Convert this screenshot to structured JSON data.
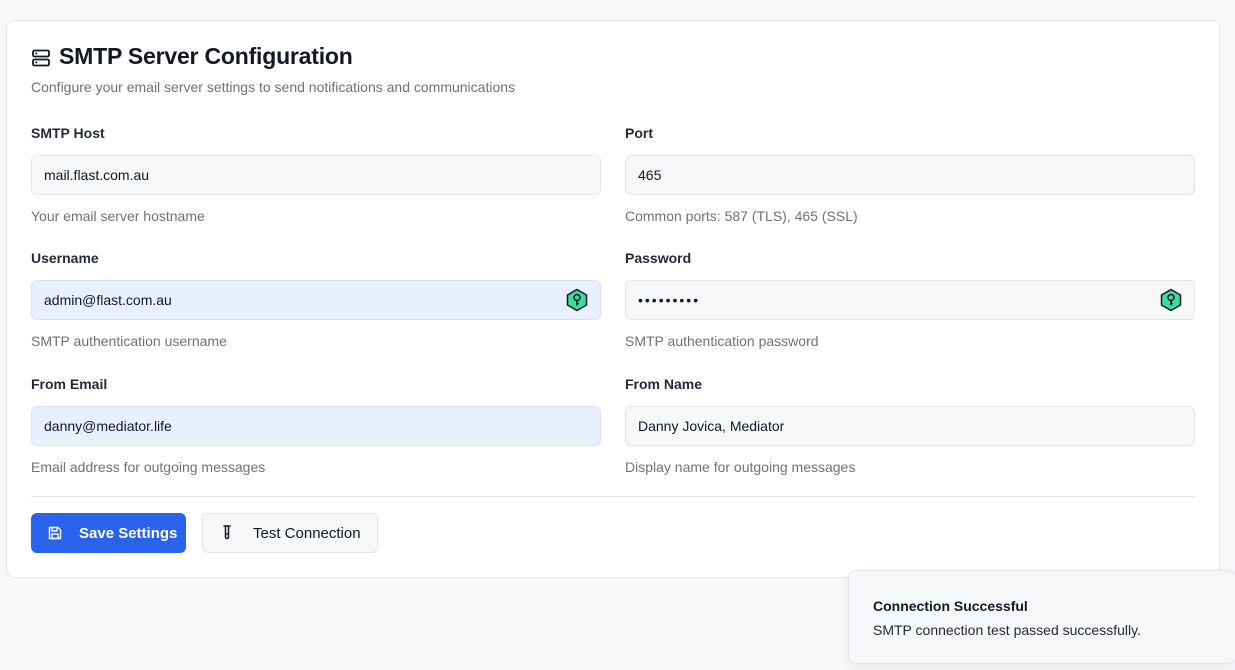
{
  "header": {
    "title": "SMTP Server Configuration",
    "icon": "server-icon",
    "subtitle": "Configure your email server settings to send notifications and communications"
  },
  "fields": {
    "smtp_host": {
      "label": "SMTP Host",
      "value": "mail.flast.com.au",
      "hint": "Your email server hostname"
    },
    "port": {
      "label": "Port",
      "value": "465",
      "hint": "Common ports: 587 (TLS), 465 (SSL)"
    },
    "username": {
      "label": "Username",
      "value": "admin@flast.com.au",
      "hint": "SMTP authentication username",
      "icon": "password-manager-key-icon"
    },
    "password": {
      "label": "Password",
      "value": "•••••••••",
      "hint": "SMTP authentication password",
      "icon": "password-manager-key-icon"
    },
    "from_email": {
      "label": "From Email",
      "value": "danny@mediator.life",
      "hint": "Email address for outgoing messages"
    },
    "from_name": {
      "label": "From Name",
      "value": "Danny Jovica, Mediator",
      "hint": "Display name for outgoing messages"
    }
  },
  "actions": {
    "save_label": "Save Settings",
    "save_icon": "save-icon",
    "test_label": "Test Connection",
    "test_icon": "test-tube-icon"
  },
  "toast": {
    "title": "Connection Successful",
    "message": "SMTP connection test passed successfully."
  },
  "colors": {
    "primary": "#2a63eb",
    "autofill_bg": "#e8f0fd",
    "key_icon_green": "#3ddc97"
  }
}
